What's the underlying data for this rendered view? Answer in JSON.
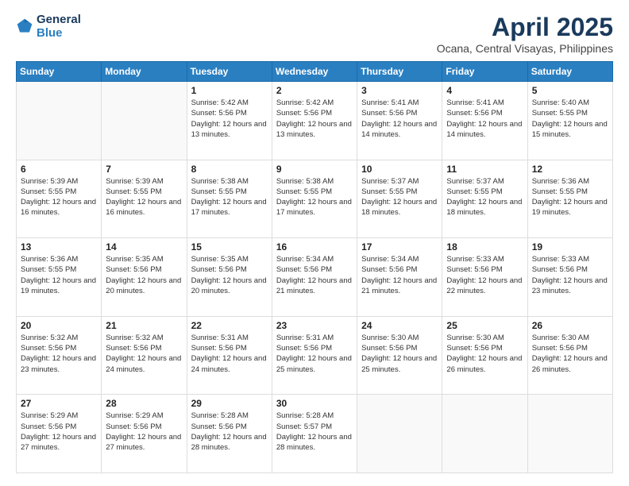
{
  "logo": {
    "line1": "General",
    "line2": "Blue"
  },
  "title": "April 2025",
  "subtitle": "Ocana, Central Visayas, Philippines",
  "weekdays": [
    "Sunday",
    "Monday",
    "Tuesday",
    "Wednesday",
    "Thursday",
    "Friday",
    "Saturday"
  ],
  "weeks": [
    [
      {
        "day": "",
        "info": ""
      },
      {
        "day": "",
        "info": ""
      },
      {
        "day": "1",
        "info": "Sunrise: 5:42 AM\nSunset: 5:56 PM\nDaylight: 12 hours and 13 minutes."
      },
      {
        "day": "2",
        "info": "Sunrise: 5:42 AM\nSunset: 5:56 PM\nDaylight: 12 hours and 13 minutes."
      },
      {
        "day": "3",
        "info": "Sunrise: 5:41 AM\nSunset: 5:56 PM\nDaylight: 12 hours and 14 minutes."
      },
      {
        "day": "4",
        "info": "Sunrise: 5:41 AM\nSunset: 5:56 PM\nDaylight: 12 hours and 14 minutes."
      },
      {
        "day": "5",
        "info": "Sunrise: 5:40 AM\nSunset: 5:55 PM\nDaylight: 12 hours and 15 minutes."
      }
    ],
    [
      {
        "day": "6",
        "info": "Sunrise: 5:39 AM\nSunset: 5:55 PM\nDaylight: 12 hours and 16 minutes."
      },
      {
        "day": "7",
        "info": "Sunrise: 5:39 AM\nSunset: 5:55 PM\nDaylight: 12 hours and 16 minutes."
      },
      {
        "day": "8",
        "info": "Sunrise: 5:38 AM\nSunset: 5:55 PM\nDaylight: 12 hours and 17 minutes."
      },
      {
        "day": "9",
        "info": "Sunrise: 5:38 AM\nSunset: 5:55 PM\nDaylight: 12 hours and 17 minutes."
      },
      {
        "day": "10",
        "info": "Sunrise: 5:37 AM\nSunset: 5:55 PM\nDaylight: 12 hours and 18 minutes."
      },
      {
        "day": "11",
        "info": "Sunrise: 5:37 AM\nSunset: 5:55 PM\nDaylight: 12 hours and 18 minutes."
      },
      {
        "day": "12",
        "info": "Sunrise: 5:36 AM\nSunset: 5:55 PM\nDaylight: 12 hours and 19 minutes."
      }
    ],
    [
      {
        "day": "13",
        "info": "Sunrise: 5:36 AM\nSunset: 5:55 PM\nDaylight: 12 hours and 19 minutes."
      },
      {
        "day": "14",
        "info": "Sunrise: 5:35 AM\nSunset: 5:56 PM\nDaylight: 12 hours and 20 minutes."
      },
      {
        "day": "15",
        "info": "Sunrise: 5:35 AM\nSunset: 5:56 PM\nDaylight: 12 hours and 20 minutes."
      },
      {
        "day": "16",
        "info": "Sunrise: 5:34 AM\nSunset: 5:56 PM\nDaylight: 12 hours and 21 minutes."
      },
      {
        "day": "17",
        "info": "Sunrise: 5:34 AM\nSunset: 5:56 PM\nDaylight: 12 hours and 21 minutes."
      },
      {
        "day": "18",
        "info": "Sunrise: 5:33 AM\nSunset: 5:56 PM\nDaylight: 12 hours and 22 minutes."
      },
      {
        "day": "19",
        "info": "Sunrise: 5:33 AM\nSunset: 5:56 PM\nDaylight: 12 hours and 23 minutes."
      }
    ],
    [
      {
        "day": "20",
        "info": "Sunrise: 5:32 AM\nSunset: 5:56 PM\nDaylight: 12 hours and 23 minutes."
      },
      {
        "day": "21",
        "info": "Sunrise: 5:32 AM\nSunset: 5:56 PM\nDaylight: 12 hours and 24 minutes."
      },
      {
        "day": "22",
        "info": "Sunrise: 5:31 AM\nSunset: 5:56 PM\nDaylight: 12 hours and 24 minutes."
      },
      {
        "day": "23",
        "info": "Sunrise: 5:31 AM\nSunset: 5:56 PM\nDaylight: 12 hours and 25 minutes."
      },
      {
        "day": "24",
        "info": "Sunrise: 5:30 AM\nSunset: 5:56 PM\nDaylight: 12 hours and 25 minutes."
      },
      {
        "day": "25",
        "info": "Sunrise: 5:30 AM\nSunset: 5:56 PM\nDaylight: 12 hours and 26 minutes."
      },
      {
        "day": "26",
        "info": "Sunrise: 5:30 AM\nSunset: 5:56 PM\nDaylight: 12 hours and 26 minutes."
      }
    ],
    [
      {
        "day": "27",
        "info": "Sunrise: 5:29 AM\nSunset: 5:56 PM\nDaylight: 12 hours and 27 minutes."
      },
      {
        "day": "28",
        "info": "Sunrise: 5:29 AM\nSunset: 5:56 PM\nDaylight: 12 hours and 27 minutes."
      },
      {
        "day": "29",
        "info": "Sunrise: 5:28 AM\nSunset: 5:56 PM\nDaylight: 12 hours and 28 minutes."
      },
      {
        "day": "30",
        "info": "Sunrise: 5:28 AM\nSunset: 5:57 PM\nDaylight: 12 hours and 28 minutes."
      },
      {
        "day": "",
        "info": ""
      },
      {
        "day": "",
        "info": ""
      },
      {
        "day": "",
        "info": ""
      }
    ]
  ]
}
